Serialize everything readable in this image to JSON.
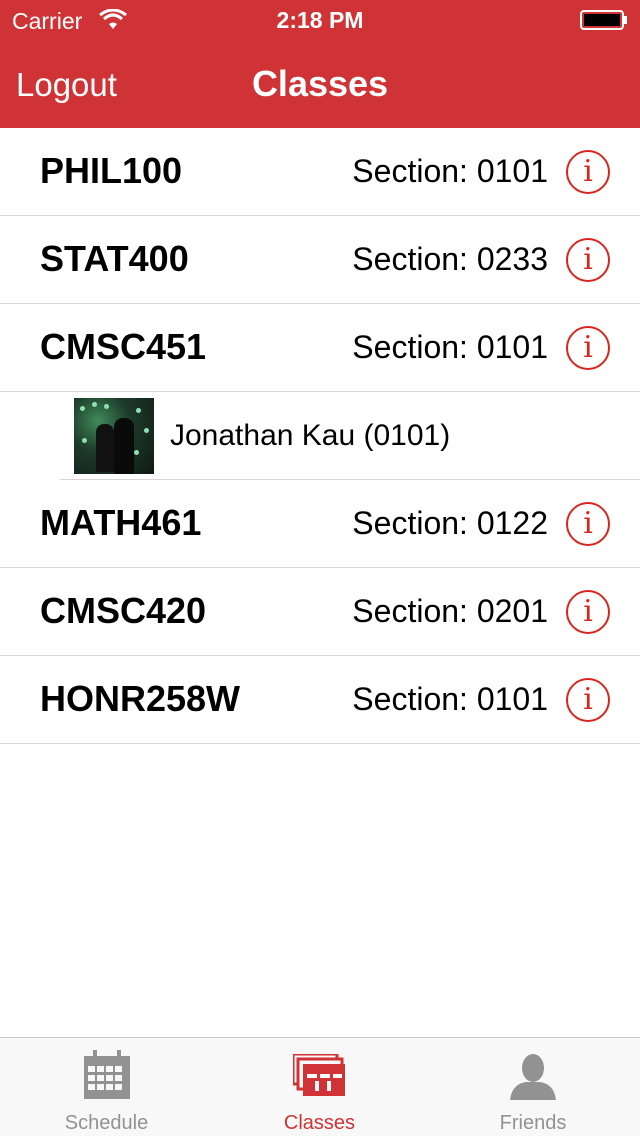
{
  "status": {
    "carrier": "Carrier",
    "time": "2:18 PM"
  },
  "nav": {
    "back_label": "Logout",
    "title": "Classes"
  },
  "classes": [
    {
      "code": "PHIL100",
      "section": "Section: 0101"
    },
    {
      "code": "STAT400",
      "section": "Section: 0233"
    },
    {
      "code": "CMSC451",
      "section": "Section: 0101"
    },
    {
      "code": "MATH461",
      "section": "Section: 0122"
    },
    {
      "code": "CMSC420",
      "section": "Section: 0201"
    },
    {
      "code": "HONR258W",
      "section": "Section: 0101"
    }
  ],
  "friend": {
    "name": "Jonathan Kau (0101)"
  },
  "info_glyph": "i",
  "tabs": [
    {
      "label": "Schedule",
      "icon": "calendar-icon"
    },
    {
      "label": "Classes",
      "icon": "classes-icon",
      "selected": true
    },
    {
      "label": "Friends",
      "icon": "person-icon"
    }
  ],
  "colors": {
    "accent": "#cf3336",
    "info": "#d9251f",
    "tab_inactive": "#929292",
    "tab_active": "#cf3336"
  }
}
